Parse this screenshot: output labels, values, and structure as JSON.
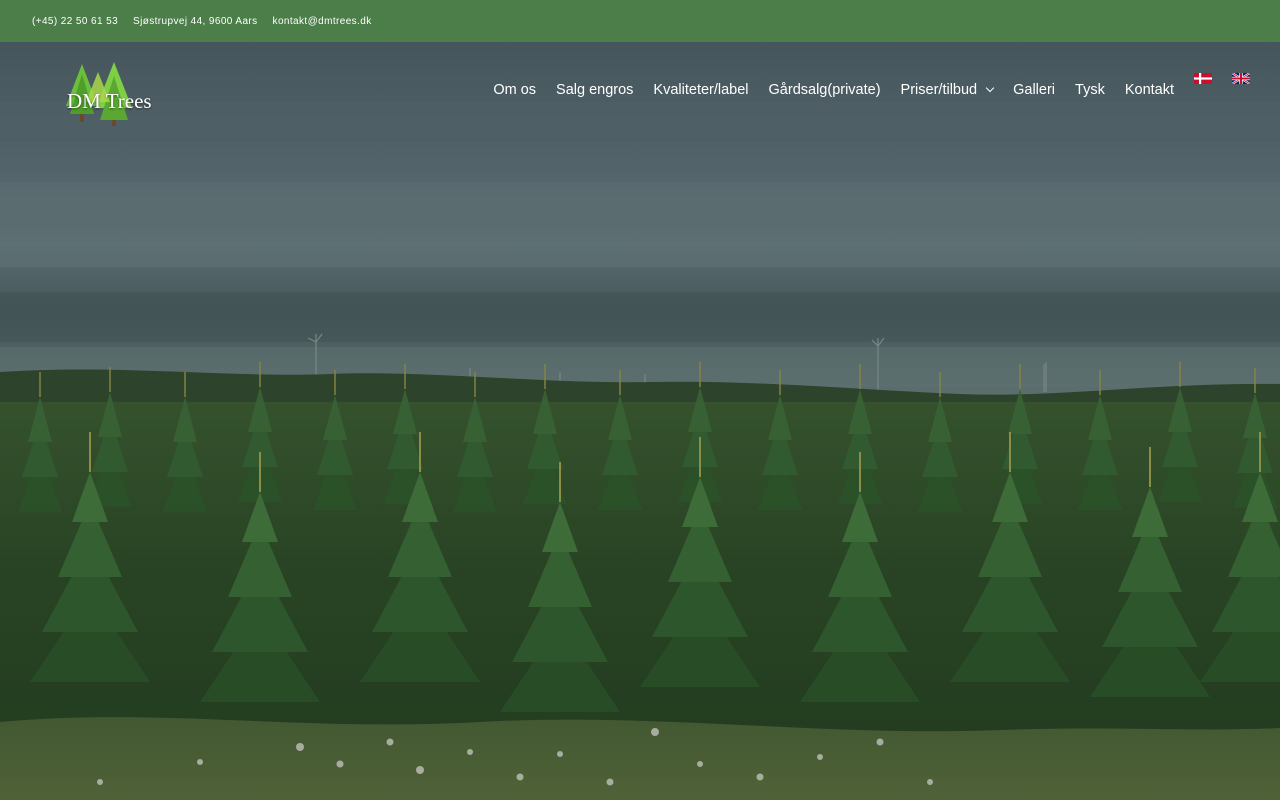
{
  "topbar": {
    "phone": "(+45) 22 50 61 53",
    "address": "Sjøstrupvej 44, 9600 Aars",
    "email": "kontakt@dmtrees.dk"
  },
  "logo": {
    "text": "DM Trees"
  },
  "nav": {
    "items": [
      {
        "label": "Om os"
      },
      {
        "label": "Salg engros"
      },
      {
        "label": "Kvaliteter/label"
      },
      {
        "label": "Gårdsalg(private)"
      },
      {
        "label": "Priser/tilbud",
        "has_submenu": true
      },
      {
        "label": "Galleri"
      },
      {
        "label": "Tysk"
      },
      {
        "label": "Kontakt"
      }
    ]
  },
  "languages": [
    {
      "code": "da",
      "icon": "danish-flag-icon"
    },
    {
      "code": "en",
      "icon": "uk-flag-icon"
    }
  ],
  "colors": {
    "topbar_bg": "#4c7e49",
    "nav_text": "#ffffff"
  }
}
